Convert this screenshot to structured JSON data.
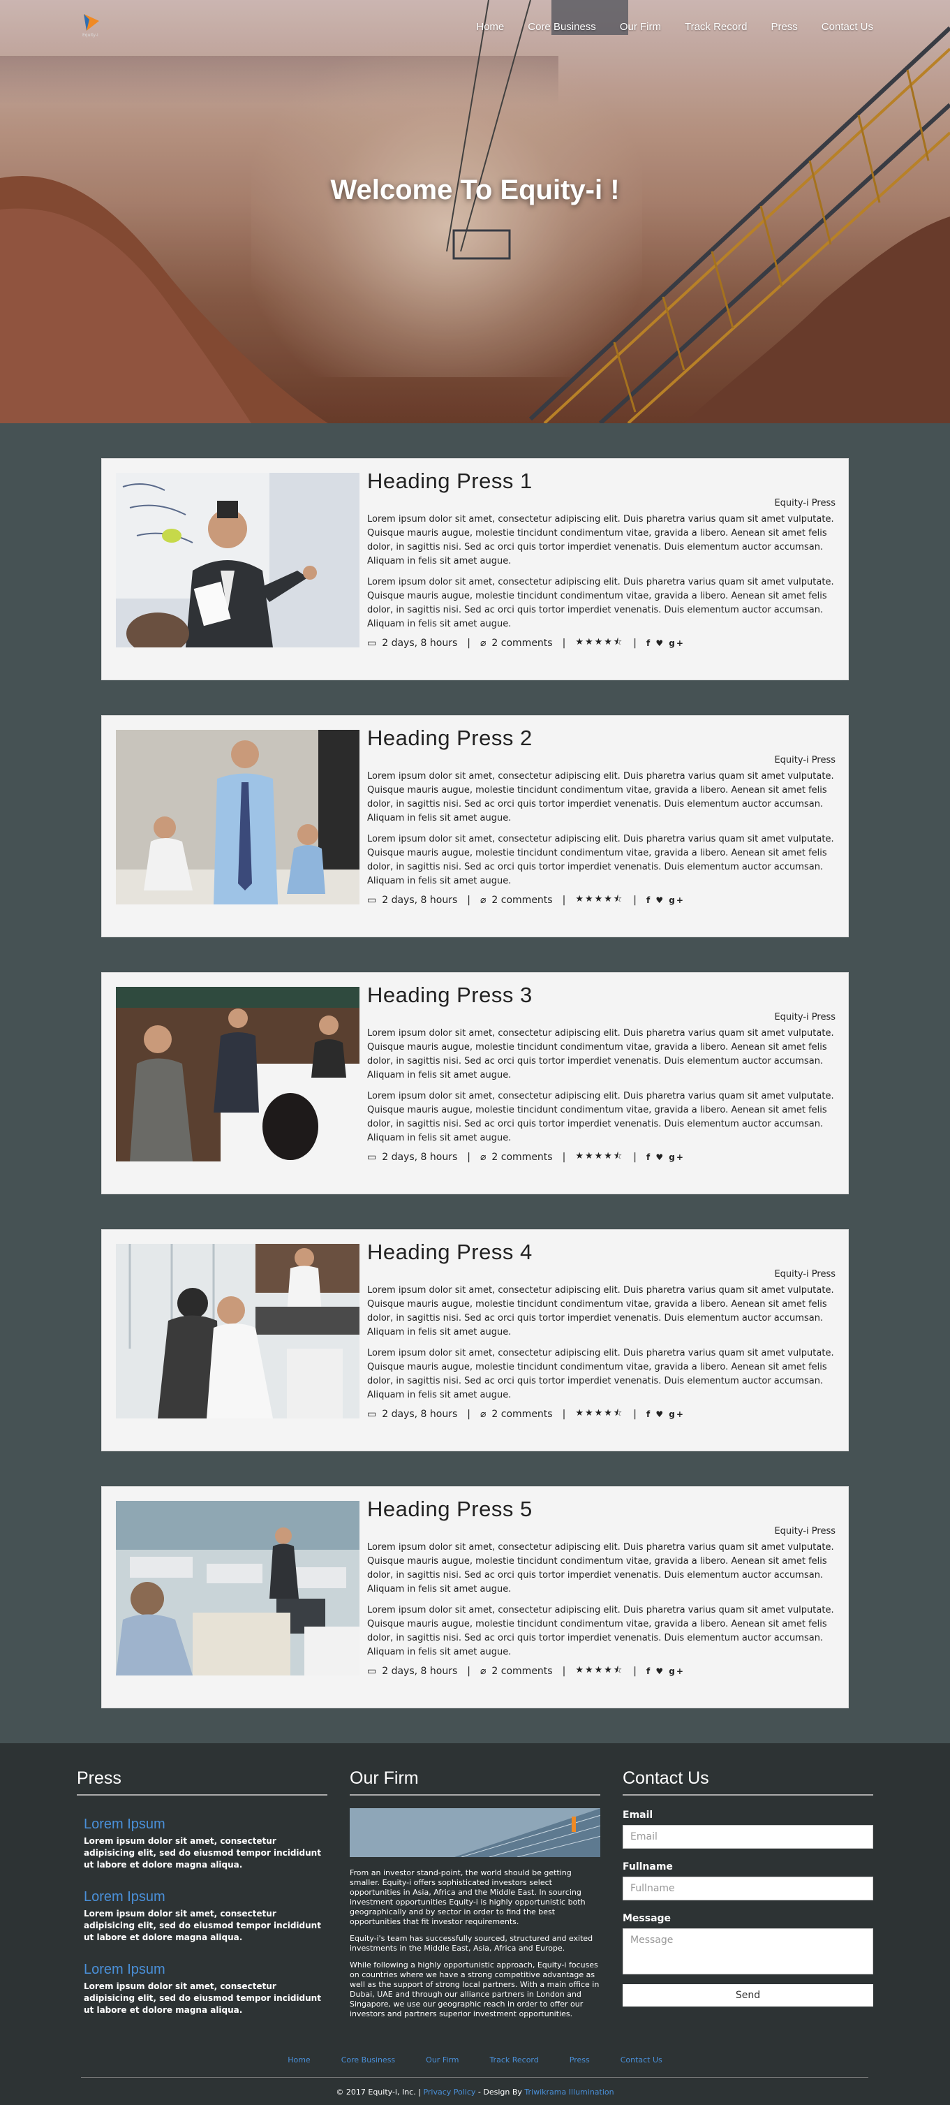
{
  "nav": {
    "logo_text": "Equity-i",
    "links": [
      "Home",
      "Core Business",
      "Our Firm",
      "Track Record",
      "Press",
      "Contact Us"
    ]
  },
  "hero": {
    "title": "Welcome To Equity-i !"
  },
  "press": {
    "cards": [
      {
        "title": "Heading Press 1",
        "author": "Equity-i Press",
        "para1": "Lorem ipsum dolor sit amet, consectetur adipiscing elit. Duis pharetra varius quam sit amet vulputate. Quisque mauris augue, molestie tincidunt condimentum vitae, gravida a libero. Aenean sit amet felis dolor, in sagittis nisi. Sed ac orci quis tortor imperdiet venenatis. Duis elementum auctor accumsan. Aliquam in felis sit amet augue.",
        "para2": "Lorem ipsum dolor sit amet, consectetur adipiscing elit. Duis pharetra varius quam sit amet vulputate. Quisque mauris augue, molestie tincidunt condimentum vitae, gravida a libero. Aenean sit amet felis dolor, in sagittis nisi. Sed ac orci quis tortor imperdiet venenatis. Duis elementum auctor accumsan. Aliquam in felis sit amet augue.",
        "time": "2 days, 8 hours",
        "comments": "2 comments",
        "rating": 4.5
      },
      {
        "title": "Heading Press 2",
        "author": "Equity-i Press",
        "para1": "Lorem ipsum dolor sit amet, consectetur adipiscing elit. Duis pharetra varius quam sit amet vulputate. Quisque mauris augue, molestie tincidunt condimentum vitae, gravida a libero. Aenean sit amet felis dolor, in sagittis nisi. Sed ac orci quis tortor imperdiet venenatis. Duis elementum auctor accumsan. Aliquam in felis sit amet augue.",
        "para2": "Lorem ipsum dolor sit amet, consectetur adipiscing elit. Duis pharetra varius quam sit amet vulputate. Quisque mauris augue, molestie tincidunt condimentum vitae, gravida a libero. Aenean sit amet felis dolor, in sagittis nisi. Sed ac orci quis tortor imperdiet venenatis. Duis elementum auctor accumsan. Aliquam in felis sit amet augue.",
        "time": "2 days, 8 hours",
        "comments": "2 comments",
        "rating": 4.5
      },
      {
        "title": "Heading Press 3",
        "author": "Equity-i Press",
        "para1": "Lorem ipsum dolor sit amet, consectetur adipiscing elit. Duis pharetra varius quam sit amet vulputate. Quisque mauris augue, molestie tincidunt condimentum vitae, gravida a libero. Aenean sit amet felis dolor, in sagittis nisi. Sed ac orci quis tortor imperdiet venenatis. Duis elementum auctor accumsan. Aliquam in felis sit amet augue.",
        "para2": "Lorem ipsum dolor sit amet, consectetur adipiscing elit. Duis pharetra varius quam sit amet vulputate. Quisque mauris augue, molestie tincidunt condimentum vitae, gravida a libero. Aenean sit amet felis dolor, in sagittis nisi. Sed ac orci quis tortor imperdiet venenatis. Duis elementum auctor accumsan. Aliquam in felis sit amet augue.",
        "time": "2 days, 8 hours",
        "comments": "2 comments",
        "rating": 4.5
      },
      {
        "title": "Heading Press 4",
        "author": "Equity-i Press",
        "para1": "Lorem ipsum dolor sit amet, consectetur adipiscing elit. Duis pharetra varius quam sit amet vulputate. Quisque mauris augue, molestie tincidunt condimentum vitae, gravida a libero. Aenean sit amet felis dolor, in sagittis nisi. Sed ac orci quis tortor imperdiet venenatis. Duis elementum auctor accumsan. Aliquam in felis sit amet augue.",
        "para2": "Lorem ipsum dolor sit amet, consectetur adipiscing elit. Duis pharetra varius quam sit amet vulputate. Quisque mauris augue, molestie tincidunt condimentum vitae, gravida a libero. Aenean sit amet felis dolor, in sagittis nisi. Sed ac orci quis tortor imperdiet venenatis. Duis elementum auctor accumsan. Aliquam in felis sit amet augue.",
        "time": "2 days, 8 hours",
        "comments": "2 comments",
        "rating": 4.5
      },
      {
        "title": "Heading Press 5",
        "author": "Equity-i Press",
        "para1": "Lorem ipsum dolor sit amet, consectetur adipiscing elit. Duis pharetra varius quam sit amet vulputate. Quisque mauris augue, molestie tincidunt condimentum vitae, gravida a libero. Aenean sit amet felis dolor, in sagittis nisi. Sed ac orci quis tortor imperdiet venenatis. Duis elementum auctor accumsan. Aliquam in felis sit amet augue.",
        "para2": "Lorem ipsum dolor sit amet, consectetur adipiscing elit. Duis pharetra varius quam sit amet vulputate. Quisque mauris augue, molestie tincidunt condimentum vitae, gravida a libero. Aenean sit amet felis dolor, in sagittis nisi. Sed ac orci quis tortor imperdiet venenatis. Duis elementum auctor accumsan. Aliquam in felis sit amet augue.",
        "time": "2 days, 8 hours",
        "comments": "2 comments",
        "rating": 4.5
      }
    ],
    "stars_text": "★★★★⯪",
    "social_text": "f ♥ g+"
  },
  "footer": {
    "press": {
      "heading": "Press",
      "items": [
        {
          "title": "Lorem Ipsum",
          "text": "Lorem ipsum dolor sit amet, consectetur adipisicing elit, sed do eiusmod tempor incididunt ut labore et dolore magna aliqua."
        },
        {
          "title": "Lorem Ipsum",
          "text": "Lorem ipsum dolor sit amet, consectetur adipisicing elit, sed do eiusmod tempor incididunt ut labore et dolore magna aliqua."
        },
        {
          "title": "Lorem Ipsum",
          "text": "Lorem ipsum dolor sit amet, consectetur adipisicing elit, sed do eiusmod tempor incididunt ut labore et dolore magna aliqua."
        }
      ]
    },
    "firm": {
      "heading": "Our Firm",
      "para1": "From an investor stand-point, the world should be getting smaller. Equity-i offers sophisticated investors select opportunities in Asia, Africa and the Middle East. In sourcing investment opportunities Equity-i is highly opportunistic both geographically and by sector in order to find the best opportunities that fit investor requirements.",
      "para2": "Equity-i's team has successfully sourced, structured and exited investments in the Middle East, Asia, Africa and Europe.",
      "para3": "While following a highly opportunistic approach, Equity-i focuses on countries where we have a strong competitive advantage as well as the support of strong local partners. With a main office in Dubai, UAE and through our alliance partners in London and Singapore, we use our geographic reach in order to offer our investors and partners superior investment opportunities."
    },
    "contact": {
      "heading": "Contact Us",
      "email_label": "Email",
      "email_placeholder": "Email",
      "name_label": "Fullname",
      "name_placeholder": "Fullname",
      "message_label": "Message",
      "message_placeholder": "Message",
      "send": "Send"
    },
    "nav": [
      "Home",
      "Core Business",
      "Our Firm",
      "Track Record",
      "Press",
      "Contact Us"
    ],
    "copyright_prefix": "© 2017 Equity-i, Inc. |",
    "privacy": "Privacy Policy",
    "design_by": "- Design By",
    "designer": "Triwikrama Illumination"
  },
  "colors": {
    "link_blue": "#4a90d9",
    "section_bg": "#465254",
    "footer_bg": "#2d3334"
  }
}
